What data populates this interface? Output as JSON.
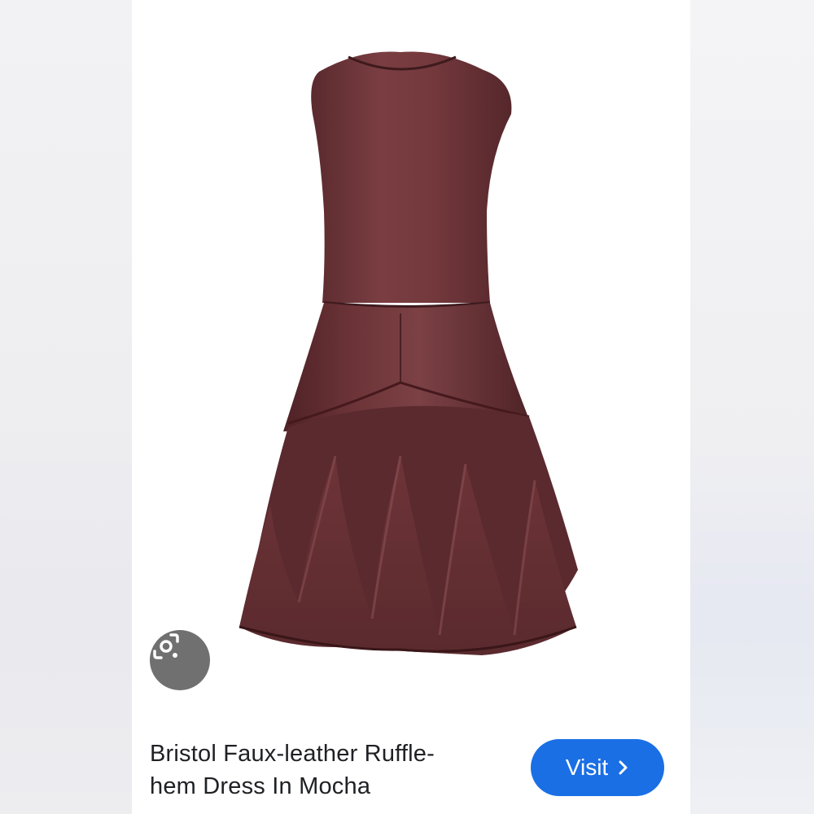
{
  "product": {
    "title_line1": "Bristol Faux-leather Ruffle-",
    "title_line2": "hem Dress In Mocha"
  },
  "actions": {
    "visit_label": "Visit"
  },
  "icons": {
    "lens": "google-lens-icon",
    "visit_chevron": "chevron-right-icon"
  },
  "colors": {
    "visit_button": "#1a6fe5",
    "lens_button": "#707070",
    "dress": "#6b3236"
  }
}
